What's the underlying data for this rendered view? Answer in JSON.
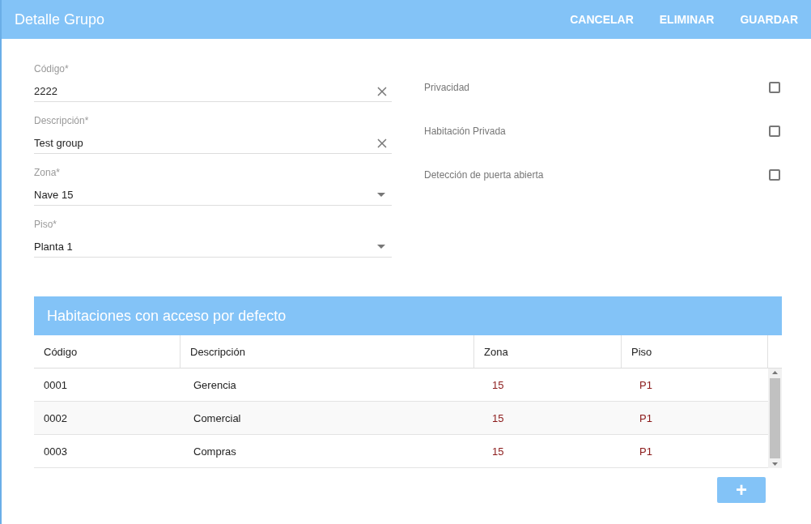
{
  "header": {
    "title": "Detalle Grupo",
    "actions": [
      "CANCELAR",
      "ELIMINAR",
      "GUARDAR"
    ]
  },
  "fields": [
    {
      "kind": "text",
      "label": "Código*",
      "value": "2222"
    },
    {
      "kind": "text",
      "label": "Descripción*",
      "value": "Test group"
    },
    {
      "kind": "select",
      "label": "Zona*",
      "value": "Nave 15"
    },
    {
      "kind": "select",
      "label": "Piso*",
      "value": "Planta 1"
    }
  ],
  "options": [
    {
      "label": "Privacidad",
      "checked": false
    },
    {
      "label": "Habitación Privada",
      "checked": false
    },
    {
      "label": "Detección de puerta abierta",
      "checked": false
    }
  ],
  "table": {
    "title": "Habitaciones con acceso por defecto",
    "columns": [
      "Código",
      "Descripción",
      "Zona",
      "Piso"
    ],
    "rows": [
      [
        "0001",
        "Gerencia",
        "15",
        "P1"
      ],
      [
        "0002",
        "Comercial",
        "15",
        "P1"
      ],
      [
        "0003",
        "Compras",
        "15",
        "P1"
      ]
    ]
  },
  "add_button": "+"
}
